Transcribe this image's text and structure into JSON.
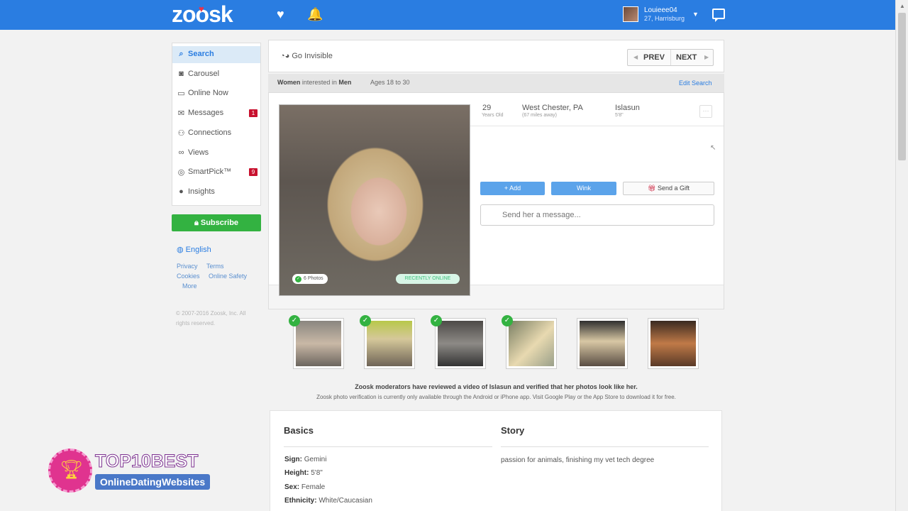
{
  "header": {
    "logo": "zoosk",
    "user": {
      "name": "Louieee04",
      "subline": "27, Harrisburg"
    }
  },
  "sidebar": {
    "items": [
      {
        "label": "Search",
        "icon": "search-icon",
        "badge": ""
      },
      {
        "label": "Carousel",
        "icon": "carousel-icon",
        "badge": ""
      },
      {
        "label": "Online Now",
        "icon": "online-icon",
        "badge": ""
      },
      {
        "label": "Messages",
        "icon": "envelope-icon",
        "badge": "1"
      },
      {
        "label": "Connections",
        "icon": "connections-icon",
        "badge": ""
      },
      {
        "label": "Views",
        "icon": "glasses-icon",
        "badge": ""
      },
      {
        "label": "SmartPick™",
        "icon": "target-icon",
        "badge": "9"
      },
      {
        "label": "Insights",
        "icon": "insights-icon",
        "badge": ""
      }
    ],
    "subscribe": "Subscribe",
    "language": "English",
    "footer_links": [
      "Privacy",
      "Terms",
      "Cookies",
      "Online Safety",
      "More"
    ],
    "copyright": "© 2007-2016 Zoosk, Inc. All rights reserved."
  },
  "main": {
    "go_invisible": "Go Invisible",
    "prev": "PREV",
    "next": "NEXT",
    "filter": {
      "women_prefix": "Women",
      "interested": " interested in ",
      "men": "Men",
      "ages": "Ages 18 to 30"
    },
    "edit_search": "Edit Search",
    "profile": {
      "photo_count": "6 Photos",
      "status": "RECENTLY ONLINE",
      "age": "29",
      "age_label": "Years Old",
      "location": "West Chester, PA",
      "distance": "(67 miles away)",
      "username": "Islasun",
      "height": "5'8\""
    },
    "actions": {
      "add": "+ Add",
      "wink": "Wink",
      "gift": "Send a Gift",
      "message_placeholder": "Send her a message..."
    },
    "verification": {
      "line1": "Zoosk moderators have reviewed a video of Islasun and verified that her photos look like her.",
      "line2": "Zoosk photo verification is currently only available through the Android or iPhone app. Visit Google Play or the App Store to download it for free."
    },
    "basics_title": "Basics",
    "story_title": "Story",
    "basics": [
      {
        "label": "Sign:",
        "value": " Gemini"
      },
      {
        "label": "Height:",
        "value": " 5'8\""
      },
      {
        "label": "Sex:",
        "value": " Female"
      },
      {
        "label": "Ethnicity:",
        "value": " White/Caucasian"
      }
    ],
    "story": "passion for animals, finishing my vet tech degree"
  },
  "watermark": {
    "line1": "TOP10BEST",
    "line2": "OnlineDatingWebsites"
  },
  "colors": {
    "brand_blue": "#2a7de1",
    "subscribe_green": "#33b241",
    "badge_red": "#c8102e"
  }
}
